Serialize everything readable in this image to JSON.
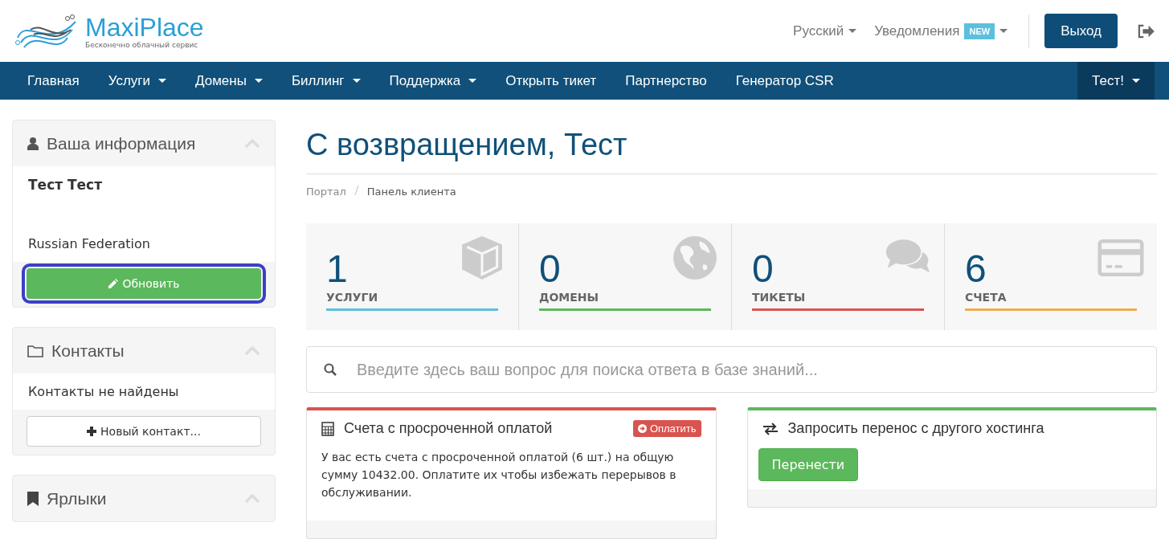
{
  "header": {
    "logo_name": "MaxiPlace",
    "logo_tagline": "Бесконечно облачный сервис",
    "language": "Русский",
    "notifications": {
      "label": "Уведомления",
      "badge": "NEW"
    },
    "logout": "Выход"
  },
  "nav": [
    {
      "label": "Главная",
      "dropdown": false,
      "kind": "main"
    },
    {
      "label": "Услуги",
      "dropdown": true,
      "kind": "main"
    },
    {
      "label": "Домены",
      "dropdown": true,
      "kind": "main"
    },
    {
      "label": "Биллинг",
      "dropdown": true,
      "kind": "main"
    },
    {
      "label": "Поддержка",
      "dropdown": true,
      "kind": "main"
    },
    {
      "label": "Открыть тикет",
      "dropdown": false,
      "kind": "main"
    },
    {
      "label": "Партнерство",
      "dropdown": false,
      "kind": "main"
    },
    {
      "label": "Генератор CSR",
      "dropdown": false,
      "kind": "main"
    },
    {
      "label": "Тест!",
      "dropdown": true,
      "kind": "account"
    }
  ],
  "sidebar": [
    {
      "title": "Ваша информация",
      "expanded": true,
      "kind": "info",
      "lines": [
        "Тест Тест",
        "Russian Federation"
      ],
      "button": {
        "label": "Обновить",
        "focused": true
      }
    },
    {
      "title": "Контакты",
      "expanded": true,
      "kind": "contacts",
      "lines": [
        "Контакты не найдены"
      ],
      "button": {
        "label": "Новый контакт...",
        "focused": false
      }
    },
    {
      "title": "Ярлыки",
      "expanded": true,
      "kind": "shortcuts"
    }
  ],
  "page": {
    "title": "С возвращением, Тест",
    "breadcrumb": [
      "Портал",
      "Панель клиента"
    ]
  },
  "stats": [
    {
      "value": "1",
      "label": "УСЛУГИ",
      "color": "#5bc0de"
    },
    {
      "value": "0",
      "label": "ДОМЕНЫ",
      "color": "#5cb85c"
    },
    {
      "value": "0",
      "label": "ТИКЕТЫ",
      "color": "#d9534f"
    },
    {
      "value": "6",
      "label": "СЧЕТА",
      "color": "#f0ad4e"
    }
  ],
  "search": {
    "placeholder": "Введите здесь ваш вопрос для поиска ответа в базе знаний..."
  },
  "panels": [
    {
      "title": "Счета с просроченной оплатой",
      "color": "#d9534f",
      "action": "Оплатить",
      "text": "У вас есть счета с просроченной оплатой (6 шт.) на общую сумму 10432.00. Оплатите их чтобы избежать перерывов в обслуживании."
    },
    {
      "title": "Запросить перенос с другого хостинга",
      "color": "#5cb85c",
      "button": "Перенести"
    }
  ]
}
